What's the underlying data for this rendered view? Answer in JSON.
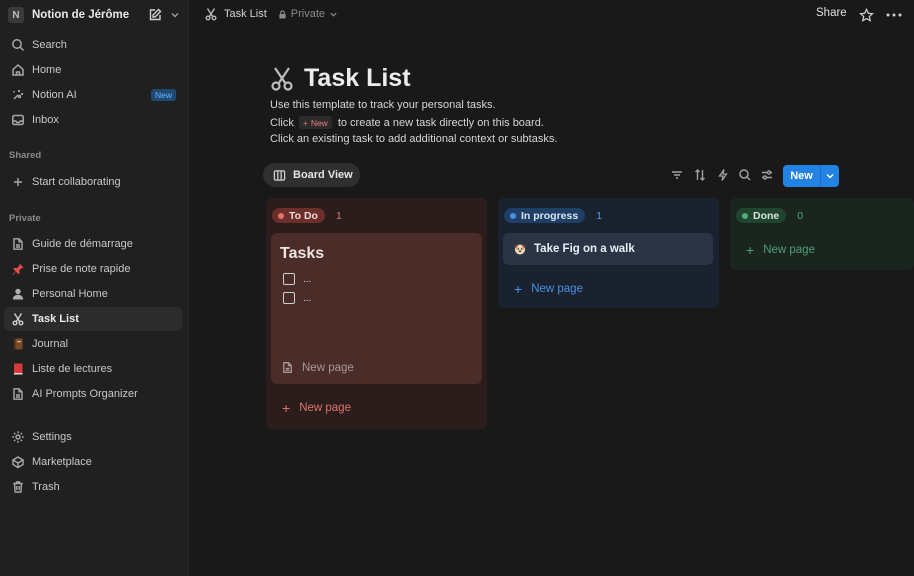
{
  "workspace": {
    "initial": "N",
    "name": "Notion de Jérôme"
  },
  "sidebar": {
    "top": [
      {
        "label": "Search",
        "icon": "search-icon"
      },
      {
        "label": "Home",
        "icon": "home-icon"
      },
      {
        "label": "Notion AI",
        "icon": "notion-ai-icon",
        "badge": "New"
      },
      {
        "label": "Inbox",
        "icon": "inbox-icon"
      }
    ],
    "shared_label": "Shared",
    "shared": [
      {
        "label": "Start collaborating",
        "icon": "plus-icon"
      }
    ],
    "private_label": "Private",
    "private": [
      {
        "label": "Guide de démarrage",
        "icon": "document-icon"
      },
      {
        "label": "Prise de note rapide",
        "icon": "pushpin-icon"
      },
      {
        "label": "Personal Home",
        "icon": "person-icon"
      },
      {
        "label": "Task List",
        "icon": "scissors-icon",
        "active": true
      },
      {
        "label": "Journal",
        "icon": "notebook-icon"
      },
      {
        "label": "Liste de lectures",
        "icon": "red-book-icon"
      },
      {
        "label": "AI Prompts Organizer",
        "icon": "document-icon"
      }
    ],
    "bottom": [
      {
        "label": "Settings",
        "icon": "gear-icon"
      },
      {
        "label": "Marketplace",
        "icon": "marketplace-icon"
      },
      {
        "label": "Trash",
        "icon": "trash-icon"
      }
    ]
  },
  "topbar": {
    "breadcrumb": "Task List",
    "privacy": "Private",
    "share_label": "Share"
  },
  "page": {
    "title": "Task List",
    "description": {
      "line1": "Use this template to track your personal tasks.",
      "line2_before": "Click",
      "inline_new_label": "New",
      "line2_after": "to create a new task directly on this board.",
      "line3": "Click an existing task to add additional context or subtasks."
    }
  },
  "view": {
    "tab_label": "Board View"
  },
  "toolbar": {
    "new_label": "New"
  },
  "board": {
    "columns": [
      {
        "name": "To Do",
        "count": "1",
        "color": "#e5736a",
        "card": {
          "title": "Tasks",
          "todos": [
            "...",
            "..."
          ],
          "new_page_label": "New page"
        },
        "add_label": "New page"
      },
      {
        "name": "In progress",
        "count": "1",
        "color": "#4a8fe0",
        "card": {
          "title": "Take Fig on a walk"
        },
        "add_label": "New page"
      },
      {
        "name": "Done",
        "count": "0",
        "color": "#4caf7d",
        "add_label": "New page"
      }
    ]
  }
}
